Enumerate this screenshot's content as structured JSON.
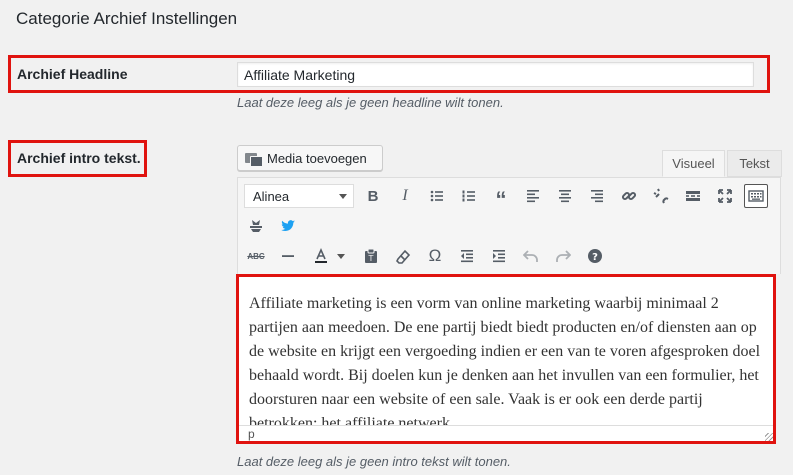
{
  "section": {
    "title": "Categorie Archief Instellingen"
  },
  "headline": {
    "label": "Archief Headline",
    "value": "Affiliate Marketing",
    "description": "Laat deze leeg als je geen headline wilt tonen."
  },
  "intro": {
    "label": "Archief intro tekst.",
    "media_button": "Media toevoegen",
    "tabs": {
      "visual": "Visueel",
      "text": "Tekst"
    },
    "format_select": "Alinea",
    "content": "Affiliate marketing is een vorm van online marketing waarbij minimaal 2 partijen aan meedoen. De ene partij biedt biedt producten en/of diensten aan op de website en krijgt een vergoeding indien er een van te voren afgesproken doel behaald wordt. Bij doelen kun je denken aan het invullen van een formulier, het doorsturen naar een website of een sale. Vaak is er ook een derde partij betrokken: het affiliate netwerk.",
    "status_path": "p",
    "description": "Laat deze leeg als je geen intro tekst wilt tonen."
  },
  "colors": {
    "highlight": "#e0130f",
    "twitter": "#1da1f2",
    "icon": "#555d66"
  }
}
